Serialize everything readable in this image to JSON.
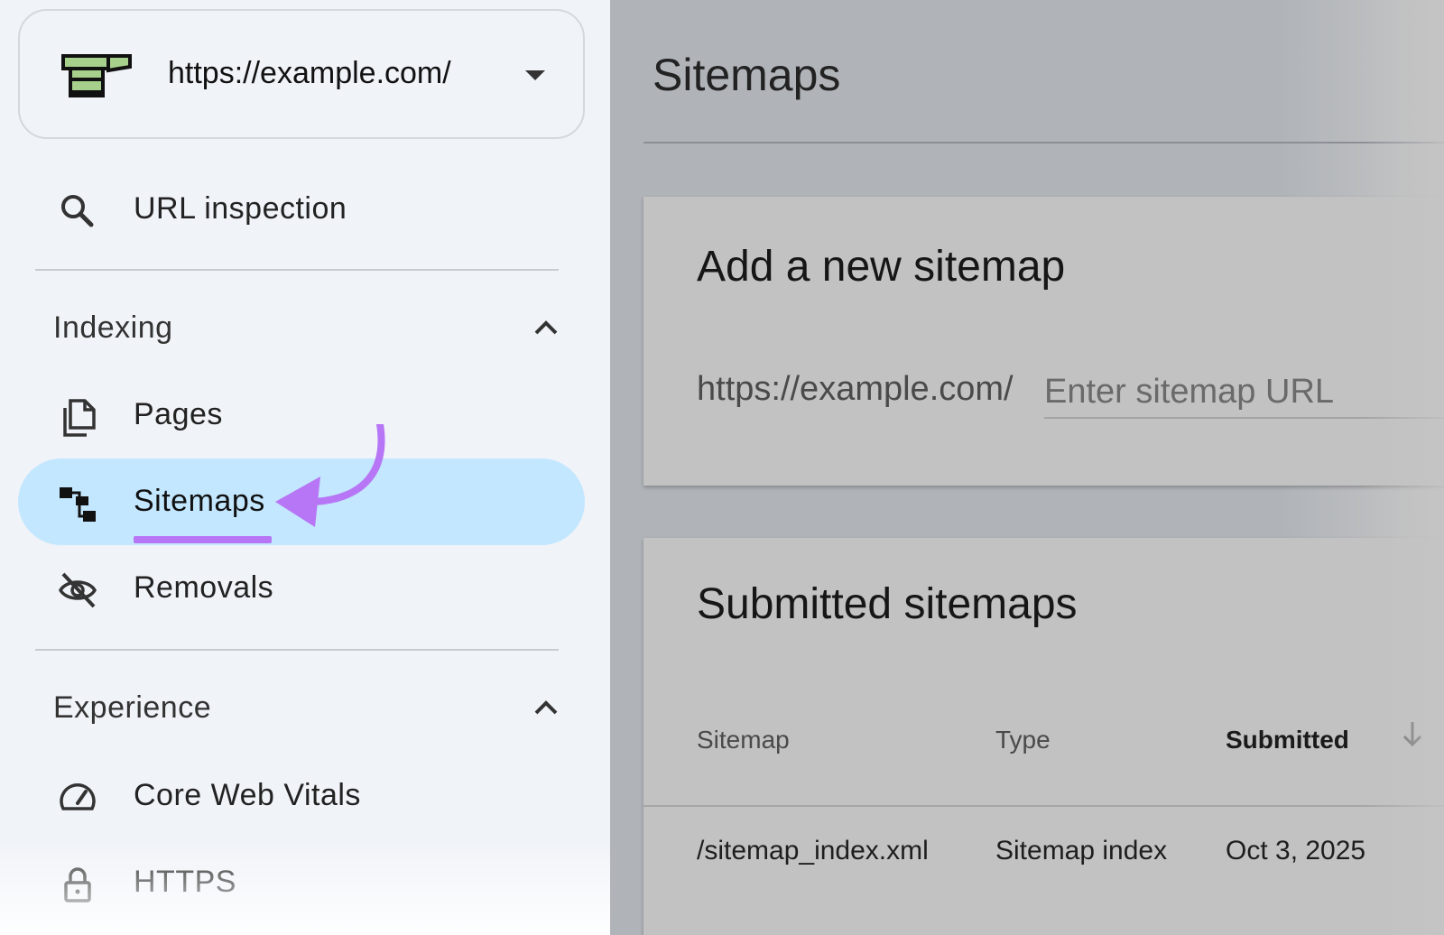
{
  "property": {
    "url": "https://example.com/"
  },
  "sidebar": {
    "url_inspection": "URL inspection",
    "sections": [
      {
        "label": "Indexing",
        "items": [
          "Pages",
          "Sitemaps",
          "Removals"
        ]
      },
      {
        "label": "Experience",
        "items": [
          "Core Web Vitals",
          "HTTPS"
        ]
      }
    ],
    "active_item": "Sitemaps"
  },
  "main": {
    "title": "Sitemaps",
    "add_card": {
      "title": "Add a new sitemap",
      "prefix": "https://example.com/",
      "placeholder": "Enter sitemap URL"
    },
    "submitted_card": {
      "title": "Submitted sitemaps",
      "columns": [
        "Sitemap",
        "Type",
        "Submitted"
      ],
      "rows": [
        {
          "sitemap": "/sitemap_index.xml",
          "type": "Sitemap index",
          "submitted": "Oct 3, 2025"
        }
      ]
    }
  },
  "colors": {
    "active_nav": "#c3e7ff",
    "annotation": "#b776f5",
    "sidebar_bg": "#f0f3f8"
  }
}
